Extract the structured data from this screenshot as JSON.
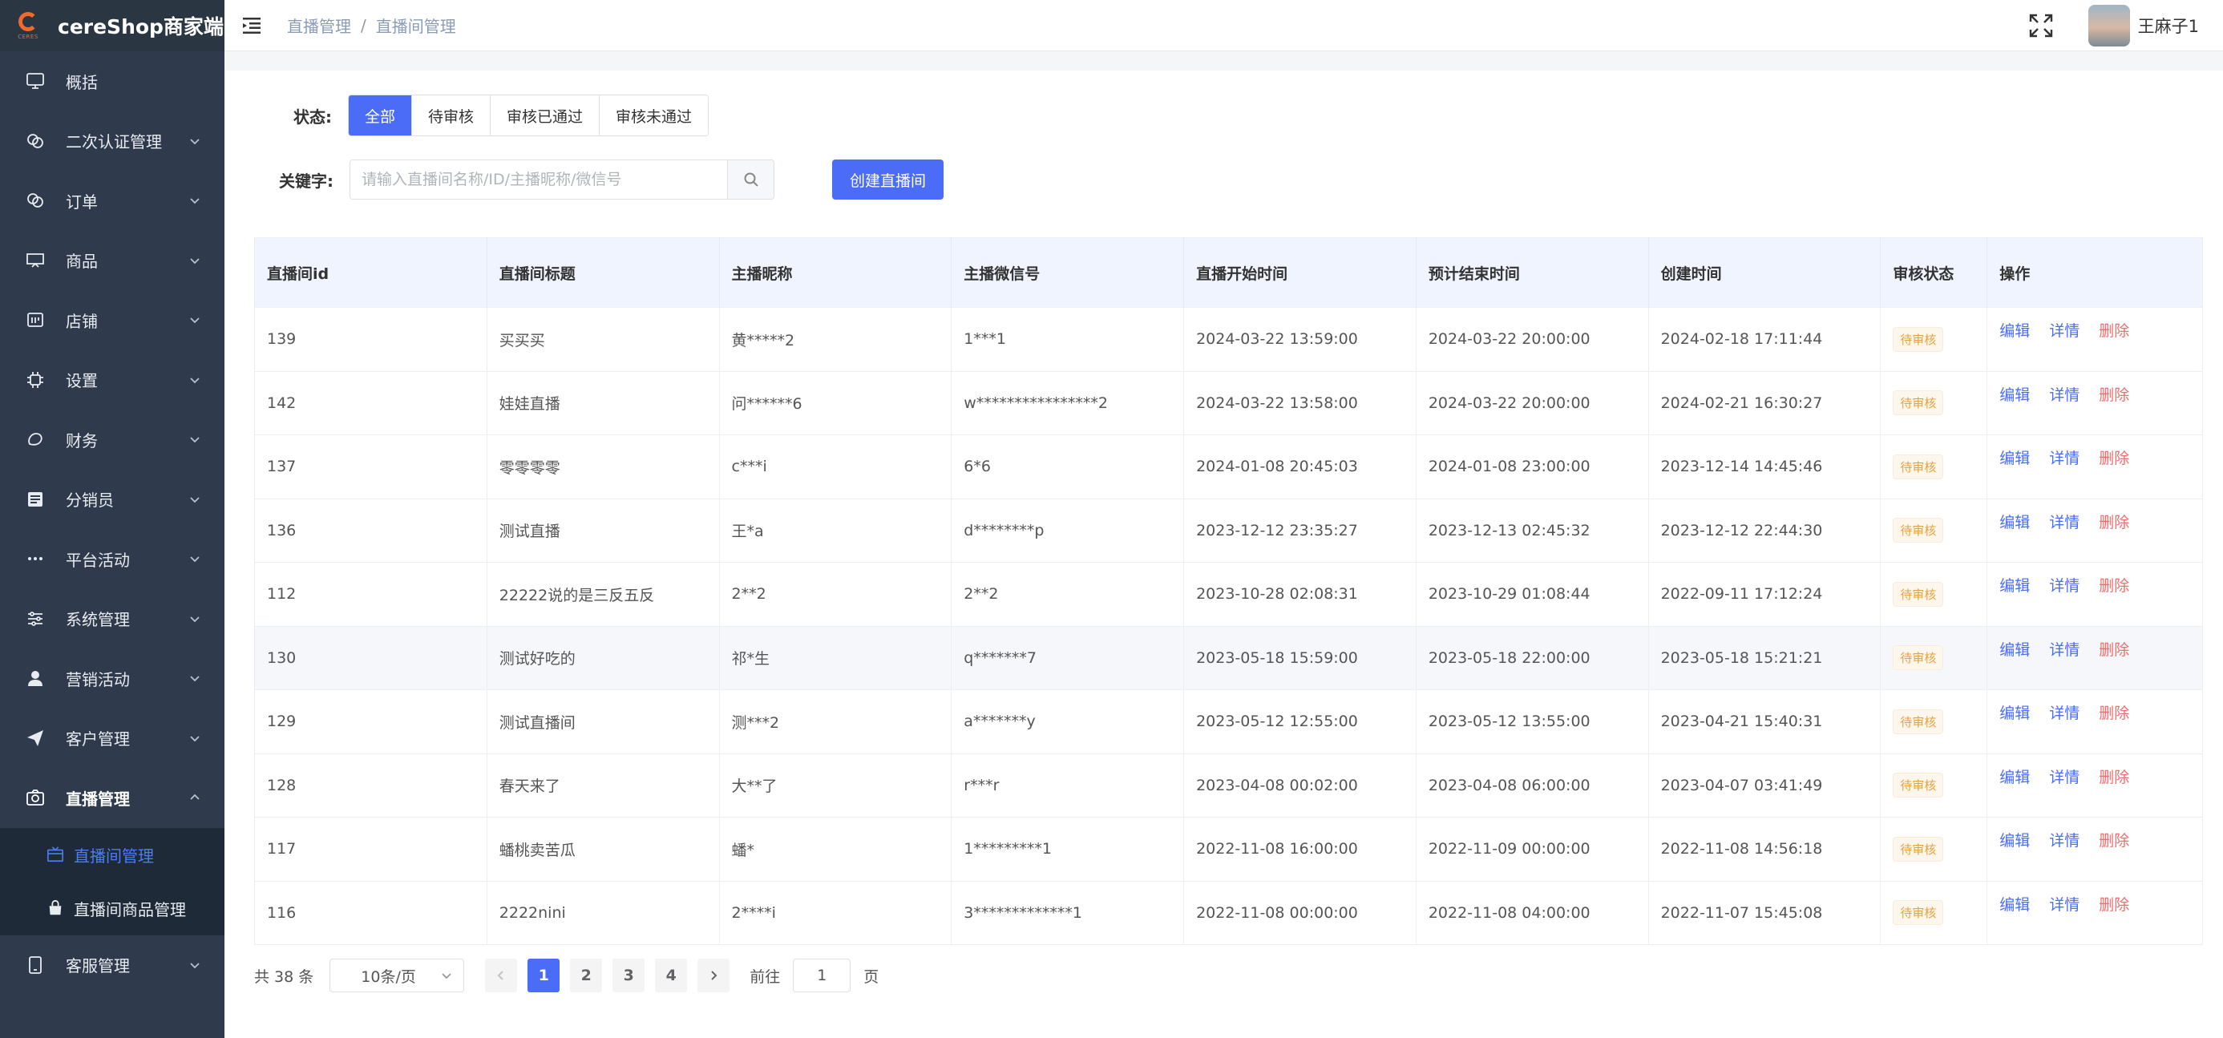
{
  "app": {
    "logo_small": "CERES",
    "title": "cereShop商家端"
  },
  "sidebar": {
    "items": [
      {
        "label": "概括",
        "icon": "monitor-icon"
      },
      {
        "label": "二次认证管理",
        "icon": "link-icon"
      },
      {
        "label": "订单",
        "icon": "link-icon"
      },
      {
        "label": "商品",
        "icon": "presentation-icon"
      },
      {
        "label": "店铺",
        "icon": "shop-icon"
      },
      {
        "label": "设置",
        "icon": "cpu-icon"
      },
      {
        "label": "财务",
        "icon": "coin-icon"
      },
      {
        "label": "分销员",
        "icon": "list-icon"
      },
      {
        "label": "平台活动",
        "icon": "more-icon"
      },
      {
        "label": "系统管理",
        "icon": "sliders-icon"
      },
      {
        "label": "营销活动",
        "icon": "user-icon"
      },
      {
        "label": "客户管理",
        "icon": "send-icon"
      },
      {
        "label": "直播管理",
        "icon": "camera-icon"
      }
    ],
    "sub_items": [
      {
        "label": "直播间管理",
        "icon": "tv-icon"
      },
      {
        "label": "直播间商品管理",
        "icon": "bag-icon"
      }
    ],
    "last_item": {
      "label": "客服管理",
      "icon": "phone-icon"
    }
  },
  "header": {
    "breadcrumb": [
      "直播管理",
      "直播间管理"
    ],
    "breadcrumb_sep": "/",
    "username": "王麻子1"
  },
  "filters": {
    "status_label": "状态:",
    "status_options": [
      "全部",
      "待审核",
      "审核已通过",
      "审核未通过"
    ],
    "keyword_label": "关键字:",
    "keyword_placeholder": "请输入直播间名称/ID/主播昵称/微信号",
    "create_button": "创建直播间"
  },
  "table": {
    "columns": [
      "直播间id",
      "直播间标题",
      "主播昵称",
      "主播微信号",
      "直播开始时间",
      "预计结束时间",
      "创建时间",
      "审核状态",
      "操作"
    ],
    "rows": [
      [
        "139",
        "买买买",
        "黄*****2",
        "1***1",
        "2024-03-22 13:59:00",
        "2024-03-22 20:00:00",
        "2024-02-18 17:11:44",
        "待审核"
      ],
      [
        "142",
        "娃娃直播",
        "问******6",
        "w****************2",
        "2024-03-22 13:58:00",
        "2024-03-22 20:00:00",
        "2024-02-21 16:30:27",
        "待审核"
      ],
      [
        "137",
        "零零零零",
        "c***i",
        "6*6",
        "2024-01-08 20:45:03",
        "2024-01-08 23:00:00",
        "2023-12-14 14:45:46",
        "待审核"
      ],
      [
        "136",
        "测试直播",
        "王*a",
        "d********p",
        "2023-12-12 23:35:27",
        "2023-12-13 02:45:32",
        "2023-12-12 22:44:30",
        "待审核"
      ],
      [
        "112",
        "22222说的是三反五反",
        "2**2",
        "2**2",
        "2023-10-28 02:08:31",
        "2023-10-29 01:08:44",
        "2022-09-11 17:12:24",
        "待审核"
      ],
      [
        "130",
        "测试好吃的",
        "祁*生",
        "q*******7",
        "2023-05-18 15:59:00",
        "2023-05-18 22:00:00",
        "2023-05-18 15:21:21",
        "待审核"
      ],
      [
        "129",
        "测试直播间",
        "测***2",
        "a*******y",
        "2023-05-12 12:55:00",
        "2023-05-12 13:55:00",
        "2023-04-21 15:40:31",
        "待审核"
      ],
      [
        "128",
        "春天来了",
        "大**了",
        "r***r",
        "2023-04-08 00:02:00",
        "2023-04-08 06:00:00",
        "2023-04-07 03:41:49",
        "待审核"
      ],
      [
        "117",
        "蟠桃卖苦瓜",
        "蟠*",
        "1*********1",
        "2022-11-08 16:00:00",
        "2022-11-09 00:00:00",
        "2022-11-08 14:56:18",
        "待审核"
      ],
      [
        "116",
        "2222nini",
        "2****i",
        "3*************1",
        "2022-11-08 00:00:00",
        "2022-11-08 04:00:00",
        "2022-11-07 15:45:08",
        "待审核"
      ]
    ],
    "actions": [
      "编辑",
      "详情",
      "删除"
    ]
  },
  "pagination": {
    "total": "共 38 条",
    "page_size": "10条/页",
    "pages": [
      "1",
      "2",
      "3",
      "4"
    ],
    "current": "1",
    "goto_prefix": "前往",
    "goto_value": "1",
    "goto_suffix": "页"
  }
}
